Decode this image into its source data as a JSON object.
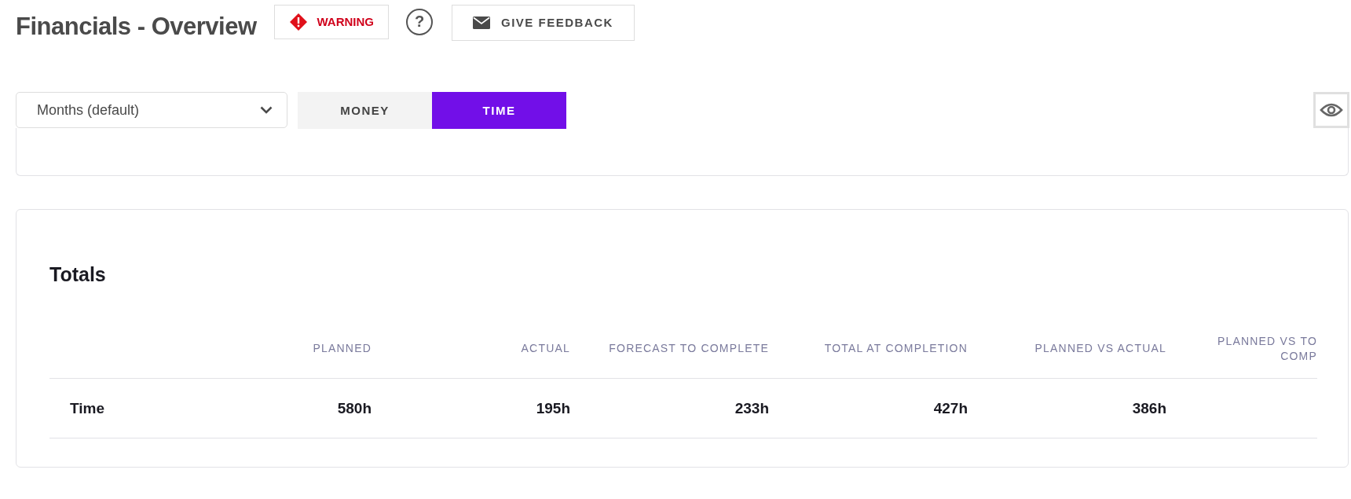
{
  "header": {
    "title": "Financials - Overview",
    "warning": "WARNING",
    "help": "?",
    "feedback": "GIVE FEEDBACK"
  },
  "toolbar": {
    "period": {
      "value": "Months (default)"
    },
    "tabs": [
      {
        "label": "MONEY",
        "selected": false
      },
      {
        "label": "TIME",
        "selected": true
      }
    ]
  },
  "totals": {
    "title": "Totals",
    "columns": [
      "PLANNED",
      "ACTUAL",
      "FORECAST TO COMPLETE",
      "TOTAL AT COMPLETION",
      "PLANNED VS ACTUAL",
      "PLANNED VS TO COMP"
    ],
    "rows": [
      {
        "label": "Time",
        "values": [
          "580h",
          "195h",
          "233h",
          "427h",
          "386h"
        ]
      }
    ]
  }
}
